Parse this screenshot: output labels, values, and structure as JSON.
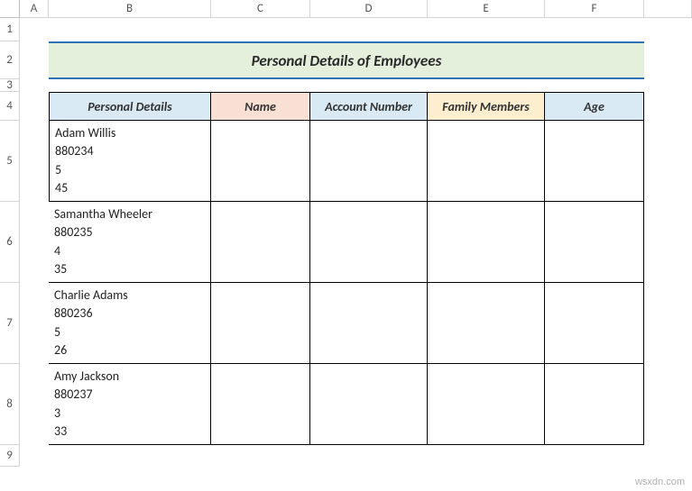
{
  "columns": [
    "A",
    "B",
    "C",
    "D",
    "E",
    "F"
  ],
  "rows": [
    "1",
    "2",
    "3",
    "4",
    "5",
    "6",
    "7",
    "8",
    "9"
  ],
  "title": "Personal Details of Employees",
  "headers": {
    "b": "Personal Details",
    "c": "Name",
    "d": "Account Number",
    "e": "Family Members",
    "f": "Age"
  },
  "data": [
    {
      "details": "Adam Willis\n880234\n5\n45",
      "name": "",
      "account": "",
      "family": "",
      "age": ""
    },
    {
      "details": "Samantha Wheeler\n880235\n4\n35",
      "name": "",
      "account": "",
      "family": "",
      "age": ""
    },
    {
      "details": "Charlie Adams\n880236\n5\n26",
      "name": "",
      "account": "",
      "family": "",
      "age": ""
    },
    {
      "details": "Amy Jackson\n880237\n3\n33",
      "name": "",
      "account": "",
      "family": "",
      "age": ""
    }
  ],
  "watermark": "wsxdn.com"
}
